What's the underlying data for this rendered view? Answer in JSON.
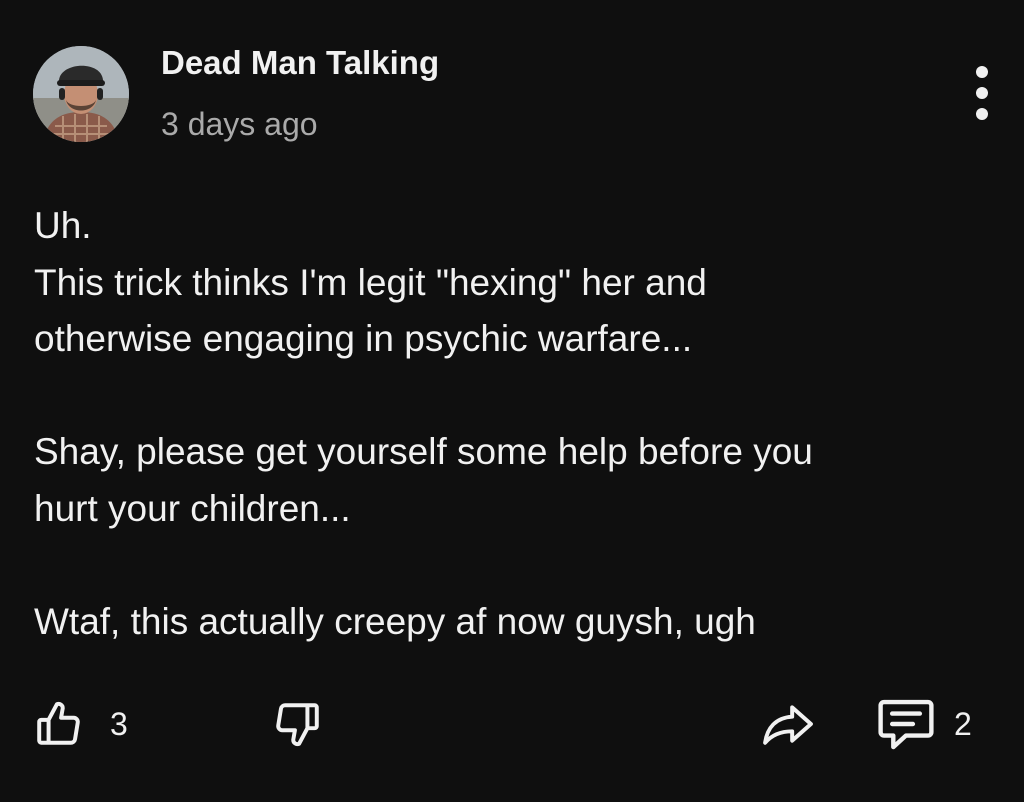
{
  "post": {
    "author": "Dead Man Talking",
    "timestamp": "3 days ago",
    "body": {
      "line1": "Uh.",
      "line2": "This trick thinks I'm legit \"hexing\" her and",
      "line3": "otherwise engaging in psychic warfare...",
      "line4": "Shay, please get yourself some help before you",
      "line5": "hurt your children...",
      "line6": "Wtaf, this actually creepy af now guysh, ugh"
    }
  },
  "actions": {
    "like_count": "3",
    "reply_count": "2"
  },
  "icons": {
    "avatar": "profile-photo",
    "menu": "more-vertical-icon",
    "like": "thumbs-up-icon",
    "dislike": "thumbs-down-icon",
    "share": "share-arrow-icon",
    "comments": "comment-icon"
  },
  "colors": {
    "background": "#0f0f0f",
    "text": "#f1f1f1",
    "secondary_text": "#aaaaaa"
  }
}
